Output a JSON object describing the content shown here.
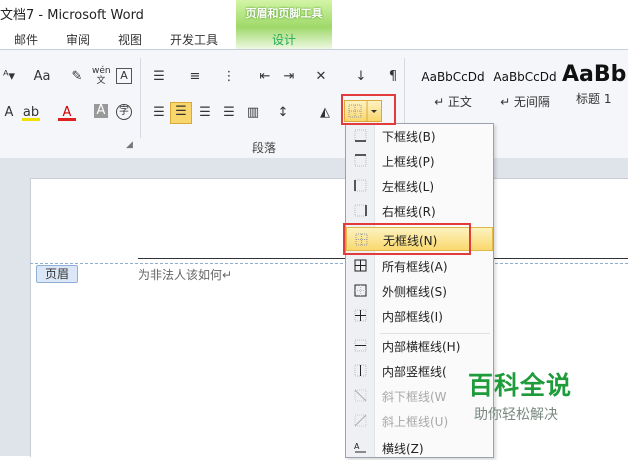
{
  "window": {
    "title": "文档7 - Microsoft Word"
  },
  "context_tab": {
    "group": "页眉和页脚工具",
    "tab": "设计"
  },
  "ribbon_tabs": [
    "邮件",
    "审阅",
    "视图",
    "开发工具"
  ],
  "ribbon": {
    "group_label": "段落",
    "font_size_label": "Aa",
    "wen_label": "wén",
    "styles": [
      {
        "sample": "AaBbCcDd",
        "name": "↵ 正文"
      },
      {
        "sample": "AaBbCcDd",
        "name": "↵ 无间隔"
      },
      {
        "sample": "AaBb",
        "name": "标题 1"
      }
    ]
  },
  "document": {
    "header_tag": "页眉",
    "header_text": "为非法人该如何↵"
  },
  "border_menu": {
    "items": [
      {
        "label": "下框线(B)",
        "icon": "bottom-border-icon",
        "state": "normal"
      },
      {
        "label": "上框线(P)",
        "icon": "top-border-icon",
        "state": "normal"
      },
      {
        "label": "左框线(L)",
        "icon": "left-border-icon",
        "state": "normal"
      },
      {
        "label": "右框线(R)",
        "icon": "right-border-icon",
        "state": "normal"
      },
      {
        "label": "无框线(N)",
        "icon": "no-border-icon",
        "state": "selected"
      },
      {
        "label": "所有框线(A)",
        "icon": "all-borders-icon",
        "state": "normal"
      },
      {
        "label": "外侧框线(S)",
        "icon": "outside-borders-icon",
        "state": "normal"
      },
      {
        "label": "内部框线(I)",
        "icon": "inside-borders-icon",
        "state": "normal"
      },
      {
        "label": "内部横框线(H)",
        "icon": "inside-horizontal-border-icon",
        "state": "normal"
      },
      {
        "label": "内部竖框线(",
        "icon": "inside-vertical-border-icon",
        "state": "normal"
      },
      {
        "label": "斜下框线(W",
        "icon": "diagonal-down-border-icon",
        "state": "disabled"
      },
      {
        "label": "斜上框线(U)",
        "icon": "diagonal-up-border-icon",
        "state": "disabled"
      },
      {
        "label": "横线(Z)",
        "icon": "horizontal-line-icon",
        "state": "normal"
      }
    ]
  },
  "watermark": {
    "title": "百科全说",
    "subtitle": "助你轻松解决"
  },
  "colors": {
    "highlight_red": "#e23b3b",
    "context_green": "#9fd86a",
    "selected_yellow": "#f9d86e"
  }
}
